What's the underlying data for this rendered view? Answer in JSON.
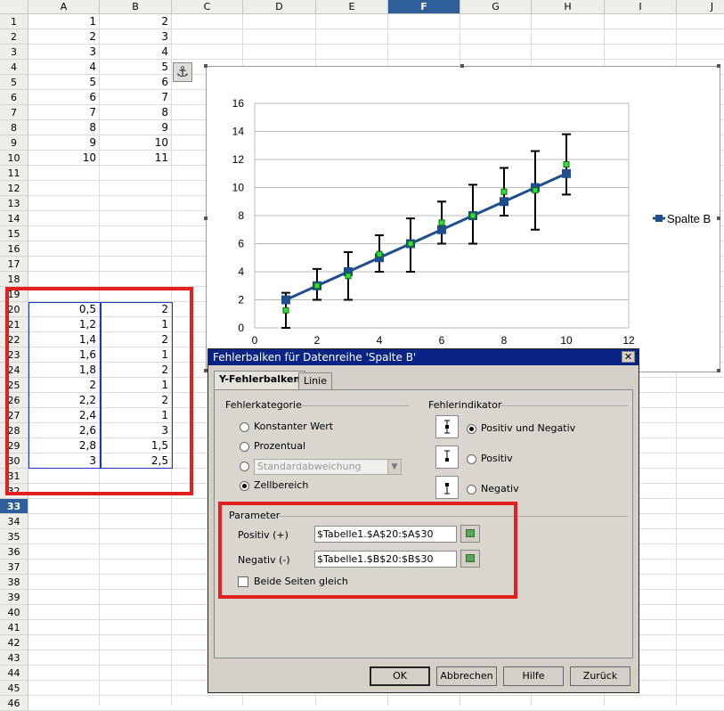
{
  "columns": [
    "A",
    "B",
    "C",
    "D",
    "E",
    "F",
    "G",
    "H",
    "I",
    "J"
  ],
  "selected_column": "F",
  "selected_row": 33,
  "row_count": 46,
  "cells_A": [
    [
      "1",
      "2"
    ],
    [
      "2",
      "3"
    ],
    [
      "3",
      "4"
    ],
    [
      "4",
      "5"
    ],
    [
      "5",
      "6"
    ],
    [
      "6",
      "7"
    ],
    [
      "7",
      "8"
    ],
    [
      "8",
      "9"
    ],
    [
      "9",
      "10"
    ],
    [
      "10",
      "11"
    ]
  ],
  "cells_err": [
    [
      "0,5",
      "2"
    ],
    [
      "1,2",
      "1"
    ],
    [
      "1,4",
      "2"
    ],
    [
      "1,6",
      "1"
    ],
    [
      "1,8",
      "2"
    ],
    [
      "2",
      "1"
    ],
    [
      "2,2",
      "2"
    ],
    [
      "2,4",
      "1"
    ],
    [
      "2,6",
      "3"
    ],
    [
      "2,8",
      "1,5"
    ],
    [
      "3",
      "2,5"
    ]
  ],
  "chart_data": {
    "type": "line",
    "x": [
      1,
      2,
      3,
      4,
      5,
      6,
      7,
      8,
      9,
      10
    ],
    "series": [
      {
        "name": "Spalte B",
        "values": [
          2,
          3,
          4,
          5,
          6,
          7,
          8,
          9,
          10,
          11
        ]
      }
    ],
    "error_plus": [
      0.5,
      1.2,
      1.4,
      1.6,
      1.8,
      2,
      2.2,
      2.4,
      2.6,
      2.8
    ],
    "error_minus": [
      2,
      1,
      2,
      1,
      2,
      1,
      2,
      1,
      3,
      1.5
    ],
    "green_points": [
      1.25,
      3.0,
      3.7,
      5.25,
      6.0,
      7.5,
      8.0,
      9.7,
      9.8,
      11.65
    ],
    "xlim": [
      0,
      12
    ],
    "ylim": [
      0,
      16
    ],
    "x_ticks": [
      "0",
      "2",
      "4",
      "6",
      "8",
      "10",
      "12"
    ],
    "y_ticks": [
      "0",
      "2",
      "4",
      "6",
      "8",
      "10",
      "12",
      "14",
      "16"
    ],
    "grid": "horizontal",
    "legend": "right",
    "color": "#1f4e8c"
  },
  "dialog": {
    "title": "Fehlerbalken für Datenreihe  'Spalte B'",
    "close": "✕",
    "tabs": [
      "Y-Fehlerbalken",
      "Linie"
    ],
    "category_label": "Fehlerkategorie",
    "options": [
      "Konstanter Wert",
      "Prozentual",
      "",
      "Zellbereich"
    ],
    "select_value": "Standardabweichung",
    "indicator_label": "Fehlerindikator",
    "indicators": [
      "Positiv und Negativ",
      "Positiv",
      "Negativ"
    ],
    "parameter_label": "Parameter",
    "positive_label": "Positiv (+)",
    "positive_value": "$Tabelle1.$A$20:$A$30",
    "negative_label": "Negativ (-)",
    "negative_value": "$Tabelle1.$B$20:$B$30",
    "same_label": "Beide Seiten gleich",
    "buttons": [
      "OK",
      "Abbrechen",
      "Hilfe",
      "Zurück"
    ]
  }
}
